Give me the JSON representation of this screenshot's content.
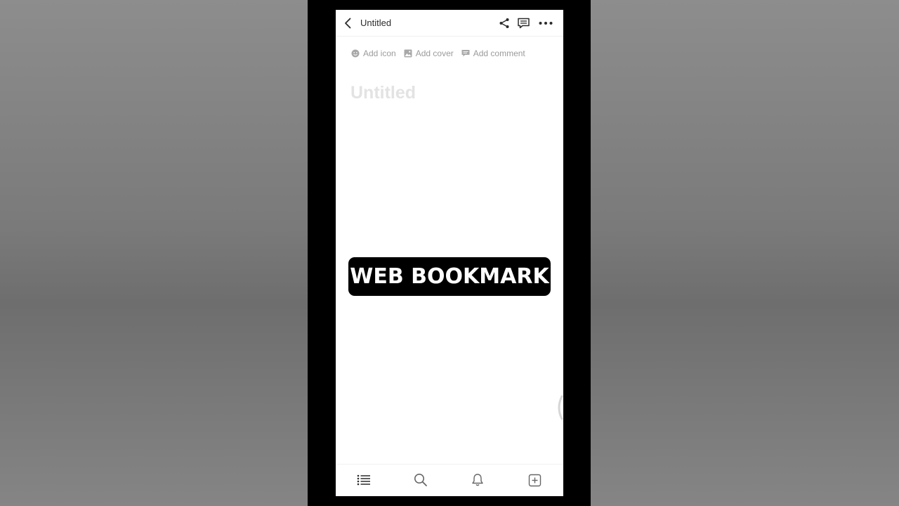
{
  "header": {
    "title": "Untitled"
  },
  "page_actions": {
    "add_icon": "Add icon",
    "add_cover": "Add cover",
    "add_comment": "Add comment"
  },
  "page": {
    "title_placeholder": "Untitled"
  },
  "overlay": {
    "caption": "WEB BOOKMARK"
  },
  "icons": {
    "back": "chevron-left-icon",
    "share": "share-icon",
    "comments": "comment-icon",
    "more": "more-horizontal-icon",
    "add_icon": "smiley-icon",
    "add_cover": "image-icon",
    "add_comment": "comment-icon",
    "nav_pages": "list-icon",
    "nav_search": "search-icon",
    "nav_updates": "bell-icon",
    "nav_new": "new-page-icon"
  },
  "colors": {
    "icon_dark": "#2b2b2b",
    "muted_text": "#9b9b9b",
    "placeholder": "#e3e3e3",
    "caption_bg": "#000000"
  }
}
